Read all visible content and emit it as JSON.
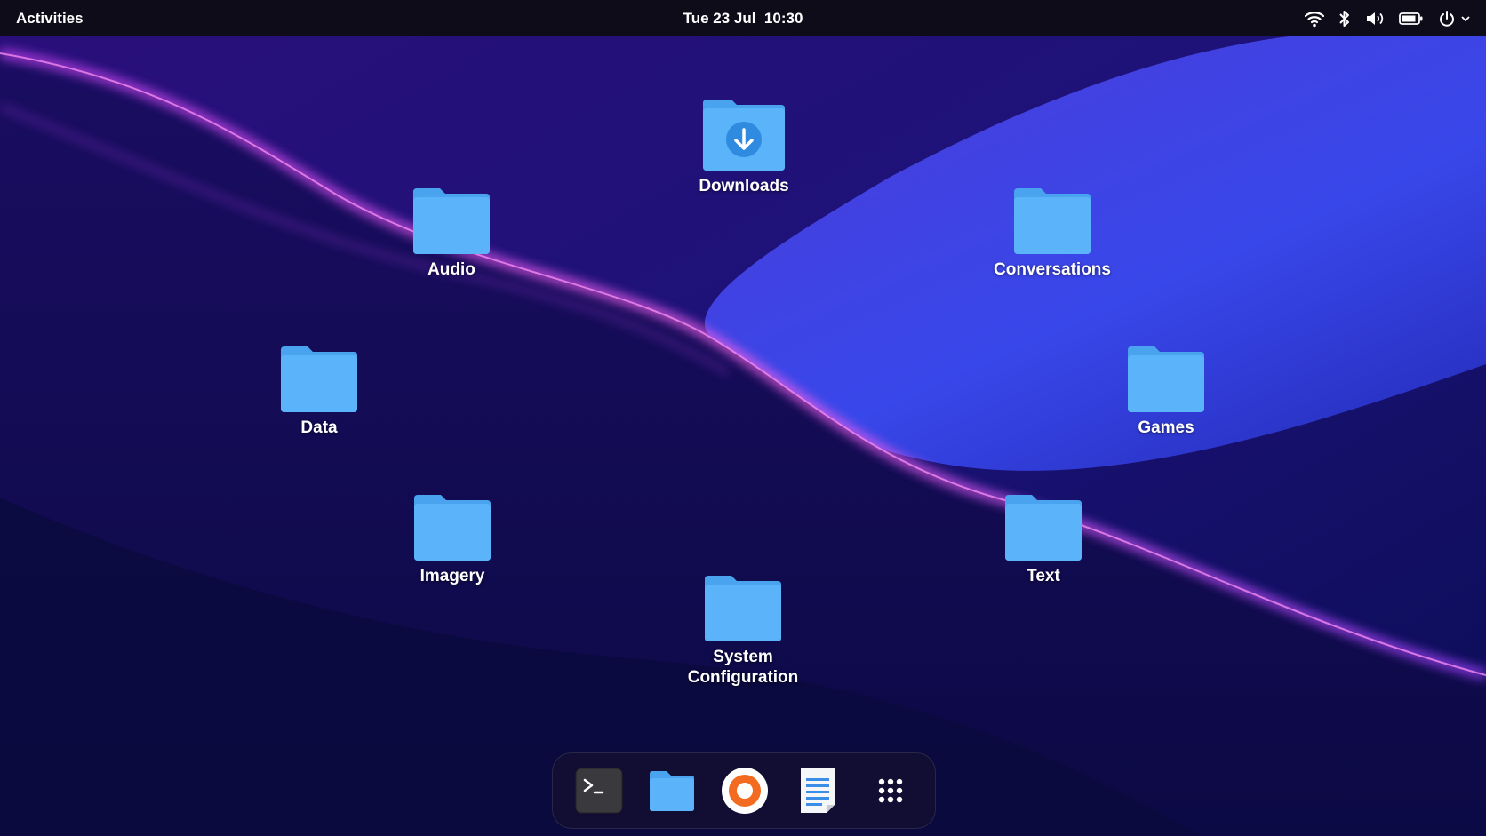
{
  "topbar": {
    "activities_label": "Activities",
    "clock": "Tue 23 Jul  10:30",
    "tray_icons": [
      "wifi-icon",
      "bluetooth-icon",
      "volume-icon",
      "battery-icon",
      "power-icon",
      "chevron-down-icon"
    ]
  },
  "desktop": {
    "folders": [
      {
        "label": "Downloads",
        "icon": "folder-download-icon"
      },
      {
        "label": "Audio",
        "icon": "folder-icon"
      },
      {
        "label": "Conversations",
        "icon": "folder-icon"
      },
      {
        "label": "Data",
        "icon": "folder-icon"
      },
      {
        "label": "Games",
        "icon": "folder-icon"
      },
      {
        "label": "Imagery",
        "icon": "folder-icon"
      },
      {
        "label": "Text",
        "icon": "folder-icon"
      },
      {
        "label": "System\nConfiguration",
        "icon": "folder-icon"
      }
    ]
  },
  "dock": {
    "items": [
      "terminal-icon",
      "files-icon",
      "browser-icon",
      "text-editor-icon",
      "app-grid-icon"
    ]
  },
  "colors": {
    "topbar": "#0e0c19",
    "folder": "#5bb4fa",
    "folder_tab": "#4aa3ee",
    "accent_pink": "#d946ef",
    "browser_orange": "#f26b21"
  }
}
